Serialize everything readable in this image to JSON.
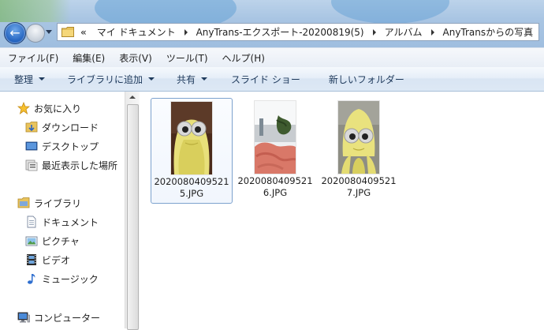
{
  "address_bar": {
    "overflow_indicator": "«",
    "breadcrumbs": [
      "マイ ドキュメント",
      "AnyTrans-エクスポート-20200819(5)",
      "アルバム",
      "AnyTransからの写真"
    ]
  },
  "menu": {
    "items": [
      "ファイル(F)",
      "編集(E)",
      "表示(V)",
      "ツール(T)",
      "ヘルプ(H)"
    ]
  },
  "toolbar": {
    "organize": "整理",
    "add_to_library": "ライブラリに追加",
    "share": "共有",
    "slideshow": "スライド ショー",
    "new_folder": "新しいフォルダー"
  },
  "nav": {
    "favorites": {
      "label": "お気に入り",
      "items": [
        "ダウンロード",
        "デスクトップ",
        "最近表示した場所"
      ]
    },
    "libraries": {
      "label": "ライブラリ",
      "items": [
        "ドキュメント",
        "ピクチャ",
        "ビデオ",
        "ミュージック"
      ]
    },
    "computer": {
      "label": "コンピューター"
    }
  },
  "files": [
    {
      "name_line1": "2020080409521",
      "name_line2": "5.JPG",
      "selected": true
    },
    {
      "name_line1": "2020080409521",
      "name_line2": "6.JPG",
      "selected": false
    },
    {
      "name_line1": "2020080409521",
      "name_line2": "7.JPG",
      "selected": false
    }
  ],
  "icons": {
    "back": "back-arrow-icon",
    "forward": "forward-arrow-icon",
    "favorites": "star-icon",
    "downloads": "download-folder-icon",
    "desktop": "desktop-icon",
    "recent": "recent-places-icon",
    "library": "library-folder-icon",
    "documents": "document-icon",
    "pictures": "picture-icon",
    "videos": "film-icon",
    "music": "music-note-icon",
    "computer": "computer-icon"
  },
  "colors": {
    "toolbar_text": "#1e395b",
    "selection_border": "#7da2ce",
    "nav_back_blue": "#1f5fbd"
  }
}
